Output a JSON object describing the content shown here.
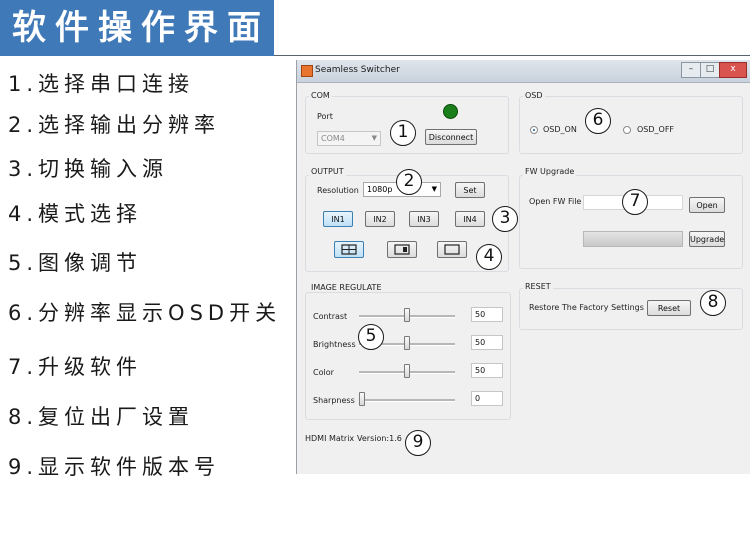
{
  "header": {
    "title": "软件操作界面"
  },
  "legend": [
    "1.选择串口连接",
    "2.选择输出分辨率",
    "3.切换输入源",
    "4.模式选择",
    "5.图像调节",
    "6.分辨率显示OSD开关",
    "7.升级软件",
    "8.复位出厂设置",
    "9.显示软件版本号"
  ],
  "window": {
    "title": "Seamless Switcher",
    "controls": {
      "minimize": "–",
      "maximize": "□",
      "close": "x"
    }
  },
  "com": {
    "group_label": "COM",
    "port_label": "Port",
    "port_value": "COM4",
    "disconnect_label": "Disconnect",
    "led_color": "#1a7f1a"
  },
  "output": {
    "group_label": "OUTPUT",
    "resolution_label": "Resolution",
    "resolution_value": "1080p",
    "set_label": "Set",
    "inputs": [
      "IN1",
      "IN2",
      "IN3",
      "IN4"
    ],
    "selected_input": "IN1",
    "layouts": [
      "quad-layout-icon",
      "pip-layout-icon",
      "single-layout-icon"
    ],
    "selected_layout": "quad-layout-icon"
  },
  "image_regulate": {
    "group_label": "IMAGE REGULATE",
    "sliders": [
      {
        "label": "Contrast",
        "value": "50",
        "level": 0.5
      },
      {
        "label": "Brightness",
        "value": "50",
        "level": 0.5
      },
      {
        "label": "Color",
        "value": "50",
        "level": 0.5
      },
      {
        "label": "Sharpness",
        "value": "0",
        "level": 0.0
      }
    ]
  },
  "osd": {
    "group_label": "OSD",
    "on_label": "OSD_ON",
    "off_label": "OSD_OFF",
    "selected": "OSD_ON"
  },
  "fw_upgrade": {
    "group_label": "FW Upgrade",
    "open_label": "Open FW File",
    "open_button": "Open",
    "upgrade_button": "Upgrade",
    "progress": 0.0
  },
  "reset": {
    "group_label": "RESET",
    "restore_label": "Restore The Factory Settings",
    "reset_button": "Reset"
  },
  "footer": {
    "product": "HDMI Matrix",
    "version": "Version:1.6"
  },
  "callouts": [
    "1",
    "2",
    "3",
    "4",
    "5",
    "6",
    "7",
    "8",
    "9"
  ]
}
